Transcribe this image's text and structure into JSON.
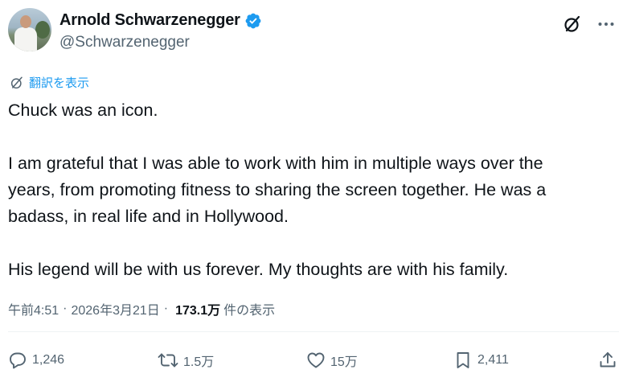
{
  "author": {
    "display_name": "Arnold Schwarzenegger",
    "handle": "@Schwarzenegger",
    "verified_icon": "verified-badge-icon",
    "verified_color": "#1d9bf0"
  },
  "top_actions": {
    "grok_icon": "grok-icon",
    "more_icon": "more-icon"
  },
  "translate": {
    "label": "翻訳を表示",
    "icon": "translate-icon"
  },
  "tweet": {
    "paragraphs": [
      [
        "Chuck was an icon."
      ],
      [
        "I am grateful that I was able to work with him in multiple ways over the",
        "years, from promoting fitness to sharing the screen together. He was a",
        "badass, in real life and in Hollywood."
      ],
      [
        "His legend will be with us forever. My thoughts are with his family."
      ]
    ]
  },
  "meta": {
    "time": "午前4:51",
    "separator": "·",
    "date": "2026年3月21日",
    "views_count": "173.1万",
    "views_label": "件の表示"
  },
  "actions": {
    "reply": {
      "icon": "reply-icon",
      "count": "1,246"
    },
    "repost": {
      "icon": "repost-icon",
      "count": "1.5万"
    },
    "like": {
      "icon": "like-icon",
      "count": "15万"
    },
    "bookmark": {
      "icon": "bookmark-icon",
      "count": "2,411"
    },
    "share": {
      "icon": "share-icon"
    }
  },
  "colors": {
    "text": "#0f1419",
    "secondary": "#536471",
    "accent": "#1d9bf0",
    "divider": "#eff3f4"
  }
}
